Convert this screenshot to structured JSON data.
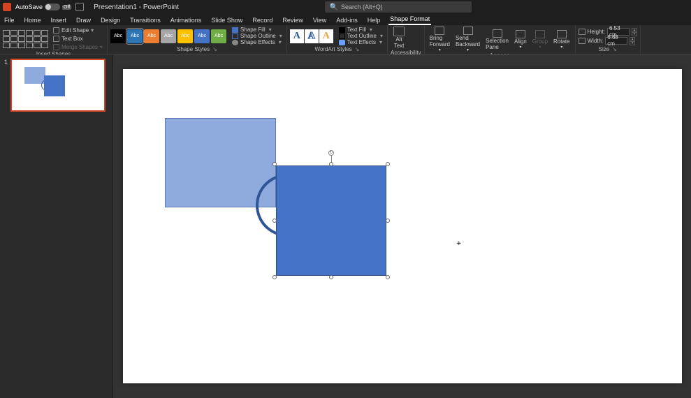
{
  "titlebar": {
    "autosave_label": "AutoSave",
    "autosave_state": "Off",
    "doc_title": "Presentation1 - PowerPoint",
    "search_placeholder": "Search (Alt+Q)"
  },
  "tabs": {
    "file": "File",
    "home": "Home",
    "insert": "Insert",
    "draw": "Draw",
    "design": "Design",
    "transitions": "Transitions",
    "animations": "Animations",
    "slideshow": "Slide Show",
    "record": "Record",
    "review": "Review",
    "view": "View",
    "addins": "Add-ins",
    "help": "Help",
    "shapeformat": "Shape Format"
  },
  "groups": {
    "insert_shapes": {
      "label": "Insert Shapes",
      "edit_shape": "Edit Shape",
      "text_box": "Text Box",
      "merge_shapes": "Merge Shapes"
    },
    "shape_styles": {
      "label": "Shape Styles",
      "swatch_text": "Abc",
      "fill": "Shape Fill",
      "outline": "Shape Outline",
      "effects": "Shape Effects"
    },
    "wordart": {
      "label": "WordArt Styles",
      "letter": "A",
      "text_fill": "Text Fill",
      "text_outline": "Text Outline",
      "text_effects": "Text Effects"
    },
    "accessibility": {
      "label": "Accessibility",
      "alt_text": "Alt\nText"
    },
    "arrange": {
      "label": "Arrange",
      "bring_forward": "Bring\nForward",
      "send_backward": "Send\nBackward",
      "selection_pane": "Selection\nPane",
      "align": "Align",
      "group": "Group",
      "rotate": "Rotate"
    },
    "size": {
      "label": "Size",
      "height_label": "Height:",
      "height_value": "6.53 cm",
      "width_label": "Width:",
      "width_value": "6.68 cm"
    }
  },
  "shape_style_colors": [
    "#000000",
    "#2e75b6",
    "#ed7d31",
    "#a5a5a5",
    "#ffc000",
    "#4472c4",
    "#70ad47"
  ],
  "thumbnail": {
    "number": "1"
  }
}
